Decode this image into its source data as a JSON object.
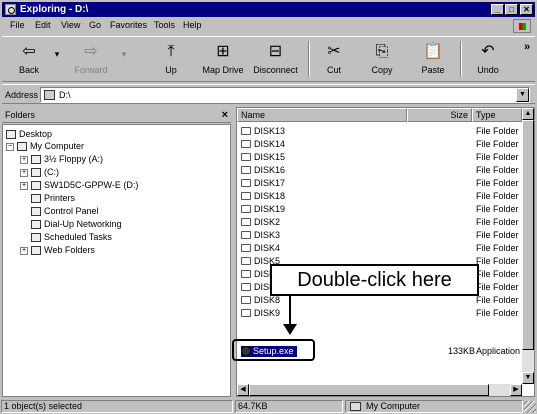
{
  "window": {
    "title": "Exploring - D:\\",
    "controls": {
      "minimize": "_",
      "maximize": "□",
      "close": "✕"
    }
  },
  "menubar": {
    "items": [
      "File",
      "Edit",
      "View",
      "Go",
      "Favorites",
      "Tools",
      "Help"
    ]
  },
  "toolbar": {
    "buttons": [
      {
        "label": "Back",
        "icon": "⇦",
        "enabled": true
      },
      {
        "label": "Forward",
        "icon": "⇨",
        "enabled": false
      },
      {
        "label": "Up",
        "icon": "⤒",
        "enabled": true
      },
      {
        "label": "Map Drive",
        "icon": "⊞",
        "enabled": true
      },
      {
        "label": "Disconnect",
        "icon": "⊟",
        "enabled": true
      },
      {
        "label": "Cut",
        "icon": "✂",
        "enabled": true
      },
      {
        "label": "Copy",
        "icon": "⎘",
        "enabled": true
      },
      {
        "label": "Paste",
        "icon": "📋",
        "enabled": true
      },
      {
        "label": "Undo",
        "icon": "↶",
        "enabled": true
      }
    ],
    "more": "»"
  },
  "address": {
    "label": "Address",
    "value": "D:\\"
  },
  "folders_pane": {
    "title": "Folders",
    "close": "×",
    "tree": [
      {
        "label": "Desktop",
        "level": 0,
        "expander": ""
      },
      {
        "label": "My Computer",
        "level": 1,
        "expander": "−"
      },
      {
        "label": "3½ Floppy (A:)",
        "level": 2,
        "expander": "+"
      },
      {
        "label": "(C:)",
        "level": 2,
        "expander": "+"
      },
      {
        "label": "SW1D5C-GPPW-E (D:)",
        "level": 2,
        "expander": "+"
      },
      {
        "label": "Printers",
        "level": 2,
        "expander": ""
      },
      {
        "label": "Control Panel",
        "level": 2,
        "expander": ""
      },
      {
        "label": "Dial-Up Networking",
        "level": 2,
        "expander": ""
      },
      {
        "label": "Scheduled Tasks",
        "level": 2,
        "expander": ""
      },
      {
        "label": "Web Folders",
        "level": 1,
        "expander": "+"
      }
    ]
  },
  "file_list": {
    "columns": {
      "name": "Name",
      "size": "Size",
      "type": "Type"
    },
    "rows": [
      {
        "name": "DISK13",
        "size": "",
        "type": "File Folder"
      },
      {
        "name": "DISK14",
        "size": "",
        "type": "File Folder"
      },
      {
        "name": "DISK15",
        "size": "",
        "type": "File Folder"
      },
      {
        "name": "DISK16",
        "size": "",
        "type": "File Folder"
      },
      {
        "name": "DISK17",
        "size": "",
        "type": "File Folder"
      },
      {
        "name": "DISK18",
        "size": "",
        "type": "File Folder"
      },
      {
        "name": "DISK19",
        "size": "",
        "type": "File Folder"
      },
      {
        "name": "DISK2",
        "size": "",
        "type": "File Folder"
      },
      {
        "name": "DISK3",
        "size": "",
        "type": "File Folder"
      },
      {
        "name": "DISK4",
        "size": "",
        "type": "File Folder"
      },
      {
        "name": "DISK5",
        "size": "",
        "type": "File Folder"
      },
      {
        "name": "DISK6",
        "size": "",
        "type": "File Folder"
      },
      {
        "name": "DISK7",
        "size": "",
        "type": "File Folder"
      },
      {
        "name": "DISK8",
        "size": "",
        "type": "File Folder"
      },
      {
        "name": "DISK9",
        "size": "",
        "type": "File Folder"
      }
    ],
    "selected": {
      "name": "Setup.exe",
      "size": "133KB",
      "type": "Application"
    }
  },
  "callout": {
    "text": "Double-click here"
  },
  "statusbar": {
    "selection": "1 object(s) selected",
    "size": "64.7KB",
    "location": "My Computer"
  },
  "colors": {
    "title_bg": "#000080",
    "selection_bg": "#000080",
    "chrome": "#c0c0c0"
  }
}
